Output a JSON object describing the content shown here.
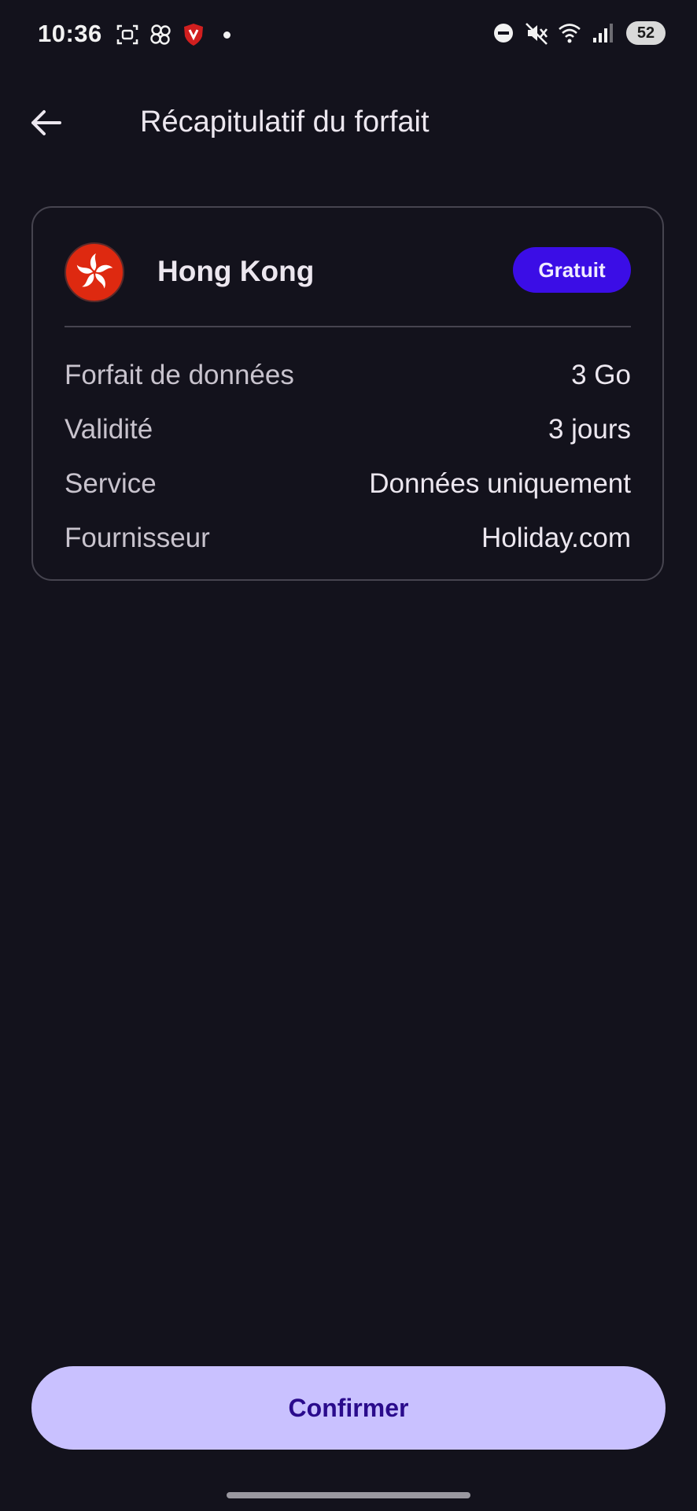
{
  "status_bar": {
    "time": "10:36",
    "battery": "52",
    "left_icons": [
      "screenshot-icon",
      "pinwheel-icon",
      "brave-shield-icon"
    ],
    "right_icons": [
      "do-not-disturb-icon",
      "mute-icon",
      "wifi-6e-icon",
      "signal-icon"
    ]
  },
  "app_bar": {
    "title": "Récapitulatif du forfait",
    "back_icon": "arrow-back-icon"
  },
  "card": {
    "country": "Hong Kong",
    "flag_icon": "hong-kong-flag-icon",
    "badge": "Gratuit",
    "details": [
      {
        "label": "Forfait de données",
        "value": "3 Go"
      },
      {
        "label": "Validité",
        "value": "3 jours"
      },
      {
        "label": "Service",
        "value": "Données uniquement"
      },
      {
        "label": "Fournisseur",
        "value": "Holiday.com"
      }
    ]
  },
  "confirm_label": "Confirmer",
  "colors": {
    "background": "#13121c",
    "badge": "#3b0de6",
    "button": "#c9c1ff",
    "button_text": "#2a0b8c",
    "flag_red": "#de2910"
  }
}
